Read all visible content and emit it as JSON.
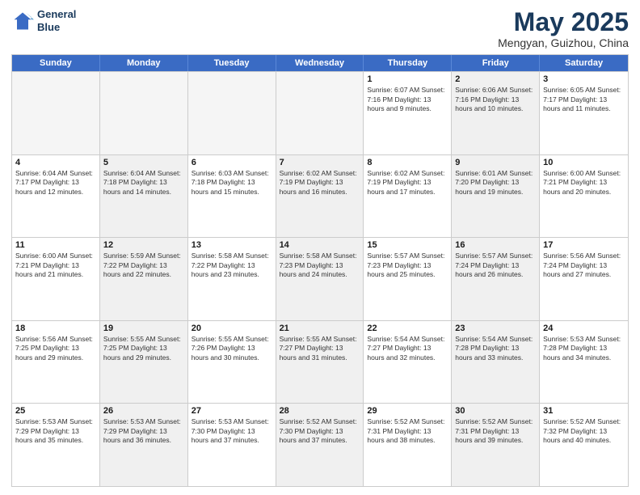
{
  "header": {
    "logo_line1": "General",
    "logo_line2": "Blue",
    "month": "May 2025",
    "location": "Mengyan, Guizhou, China"
  },
  "days_of_week": [
    "Sunday",
    "Monday",
    "Tuesday",
    "Wednesday",
    "Thursday",
    "Friday",
    "Saturday"
  ],
  "rows": [
    [
      {
        "day": "",
        "text": "",
        "empty": true
      },
      {
        "day": "",
        "text": "",
        "empty": true
      },
      {
        "day": "",
        "text": "",
        "empty": true
      },
      {
        "day": "",
        "text": "",
        "empty": true
      },
      {
        "day": "1",
        "text": "Sunrise: 6:07 AM\nSunset: 7:16 PM\nDaylight: 13 hours\nand 9 minutes.",
        "shaded": false
      },
      {
        "day": "2",
        "text": "Sunrise: 6:06 AM\nSunset: 7:16 PM\nDaylight: 13 hours\nand 10 minutes.",
        "shaded": true
      },
      {
        "day": "3",
        "text": "Sunrise: 6:05 AM\nSunset: 7:17 PM\nDaylight: 13 hours\nand 11 minutes.",
        "shaded": false
      }
    ],
    [
      {
        "day": "4",
        "text": "Sunrise: 6:04 AM\nSunset: 7:17 PM\nDaylight: 13 hours\nand 12 minutes.",
        "shaded": false
      },
      {
        "day": "5",
        "text": "Sunrise: 6:04 AM\nSunset: 7:18 PM\nDaylight: 13 hours\nand 14 minutes.",
        "shaded": true
      },
      {
        "day": "6",
        "text": "Sunrise: 6:03 AM\nSunset: 7:18 PM\nDaylight: 13 hours\nand 15 minutes.",
        "shaded": false
      },
      {
        "day": "7",
        "text": "Sunrise: 6:02 AM\nSunset: 7:19 PM\nDaylight: 13 hours\nand 16 minutes.",
        "shaded": true
      },
      {
        "day": "8",
        "text": "Sunrise: 6:02 AM\nSunset: 7:19 PM\nDaylight: 13 hours\nand 17 minutes.",
        "shaded": false
      },
      {
        "day": "9",
        "text": "Sunrise: 6:01 AM\nSunset: 7:20 PM\nDaylight: 13 hours\nand 19 minutes.",
        "shaded": true
      },
      {
        "day": "10",
        "text": "Sunrise: 6:00 AM\nSunset: 7:21 PM\nDaylight: 13 hours\nand 20 minutes.",
        "shaded": false
      }
    ],
    [
      {
        "day": "11",
        "text": "Sunrise: 6:00 AM\nSunset: 7:21 PM\nDaylight: 13 hours\nand 21 minutes.",
        "shaded": false
      },
      {
        "day": "12",
        "text": "Sunrise: 5:59 AM\nSunset: 7:22 PM\nDaylight: 13 hours\nand 22 minutes.",
        "shaded": true
      },
      {
        "day": "13",
        "text": "Sunrise: 5:58 AM\nSunset: 7:22 PM\nDaylight: 13 hours\nand 23 minutes.",
        "shaded": false
      },
      {
        "day": "14",
        "text": "Sunrise: 5:58 AM\nSunset: 7:23 PM\nDaylight: 13 hours\nand 24 minutes.",
        "shaded": true
      },
      {
        "day": "15",
        "text": "Sunrise: 5:57 AM\nSunset: 7:23 PM\nDaylight: 13 hours\nand 25 minutes.",
        "shaded": false
      },
      {
        "day": "16",
        "text": "Sunrise: 5:57 AM\nSunset: 7:24 PM\nDaylight: 13 hours\nand 26 minutes.",
        "shaded": true
      },
      {
        "day": "17",
        "text": "Sunrise: 5:56 AM\nSunset: 7:24 PM\nDaylight: 13 hours\nand 27 minutes.",
        "shaded": false
      }
    ],
    [
      {
        "day": "18",
        "text": "Sunrise: 5:56 AM\nSunset: 7:25 PM\nDaylight: 13 hours\nand 29 minutes.",
        "shaded": false
      },
      {
        "day": "19",
        "text": "Sunrise: 5:55 AM\nSunset: 7:25 PM\nDaylight: 13 hours\nand 29 minutes.",
        "shaded": true
      },
      {
        "day": "20",
        "text": "Sunrise: 5:55 AM\nSunset: 7:26 PM\nDaylight: 13 hours\nand 30 minutes.",
        "shaded": false
      },
      {
        "day": "21",
        "text": "Sunrise: 5:55 AM\nSunset: 7:27 PM\nDaylight: 13 hours\nand 31 minutes.",
        "shaded": true
      },
      {
        "day": "22",
        "text": "Sunrise: 5:54 AM\nSunset: 7:27 PM\nDaylight: 13 hours\nand 32 minutes.",
        "shaded": false
      },
      {
        "day": "23",
        "text": "Sunrise: 5:54 AM\nSunset: 7:28 PM\nDaylight: 13 hours\nand 33 minutes.",
        "shaded": true
      },
      {
        "day": "24",
        "text": "Sunrise: 5:53 AM\nSunset: 7:28 PM\nDaylight: 13 hours\nand 34 minutes.",
        "shaded": false
      }
    ],
    [
      {
        "day": "25",
        "text": "Sunrise: 5:53 AM\nSunset: 7:29 PM\nDaylight: 13 hours\nand 35 minutes.",
        "shaded": false
      },
      {
        "day": "26",
        "text": "Sunrise: 5:53 AM\nSunset: 7:29 PM\nDaylight: 13 hours\nand 36 minutes.",
        "shaded": true
      },
      {
        "day": "27",
        "text": "Sunrise: 5:53 AM\nSunset: 7:30 PM\nDaylight: 13 hours\nand 37 minutes.",
        "shaded": false
      },
      {
        "day": "28",
        "text": "Sunrise: 5:52 AM\nSunset: 7:30 PM\nDaylight: 13 hours\nand 37 minutes.",
        "shaded": true
      },
      {
        "day": "29",
        "text": "Sunrise: 5:52 AM\nSunset: 7:31 PM\nDaylight: 13 hours\nand 38 minutes.",
        "shaded": false
      },
      {
        "day": "30",
        "text": "Sunrise: 5:52 AM\nSunset: 7:31 PM\nDaylight: 13 hours\nand 39 minutes.",
        "shaded": true
      },
      {
        "day": "31",
        "text": "Sunrise: 5:52 AM\nSunset: 7:32 PM\nDaylight: 13 hours\nand 40 minutes.",
        "shaded": false
      }
    ]
  ]
}
